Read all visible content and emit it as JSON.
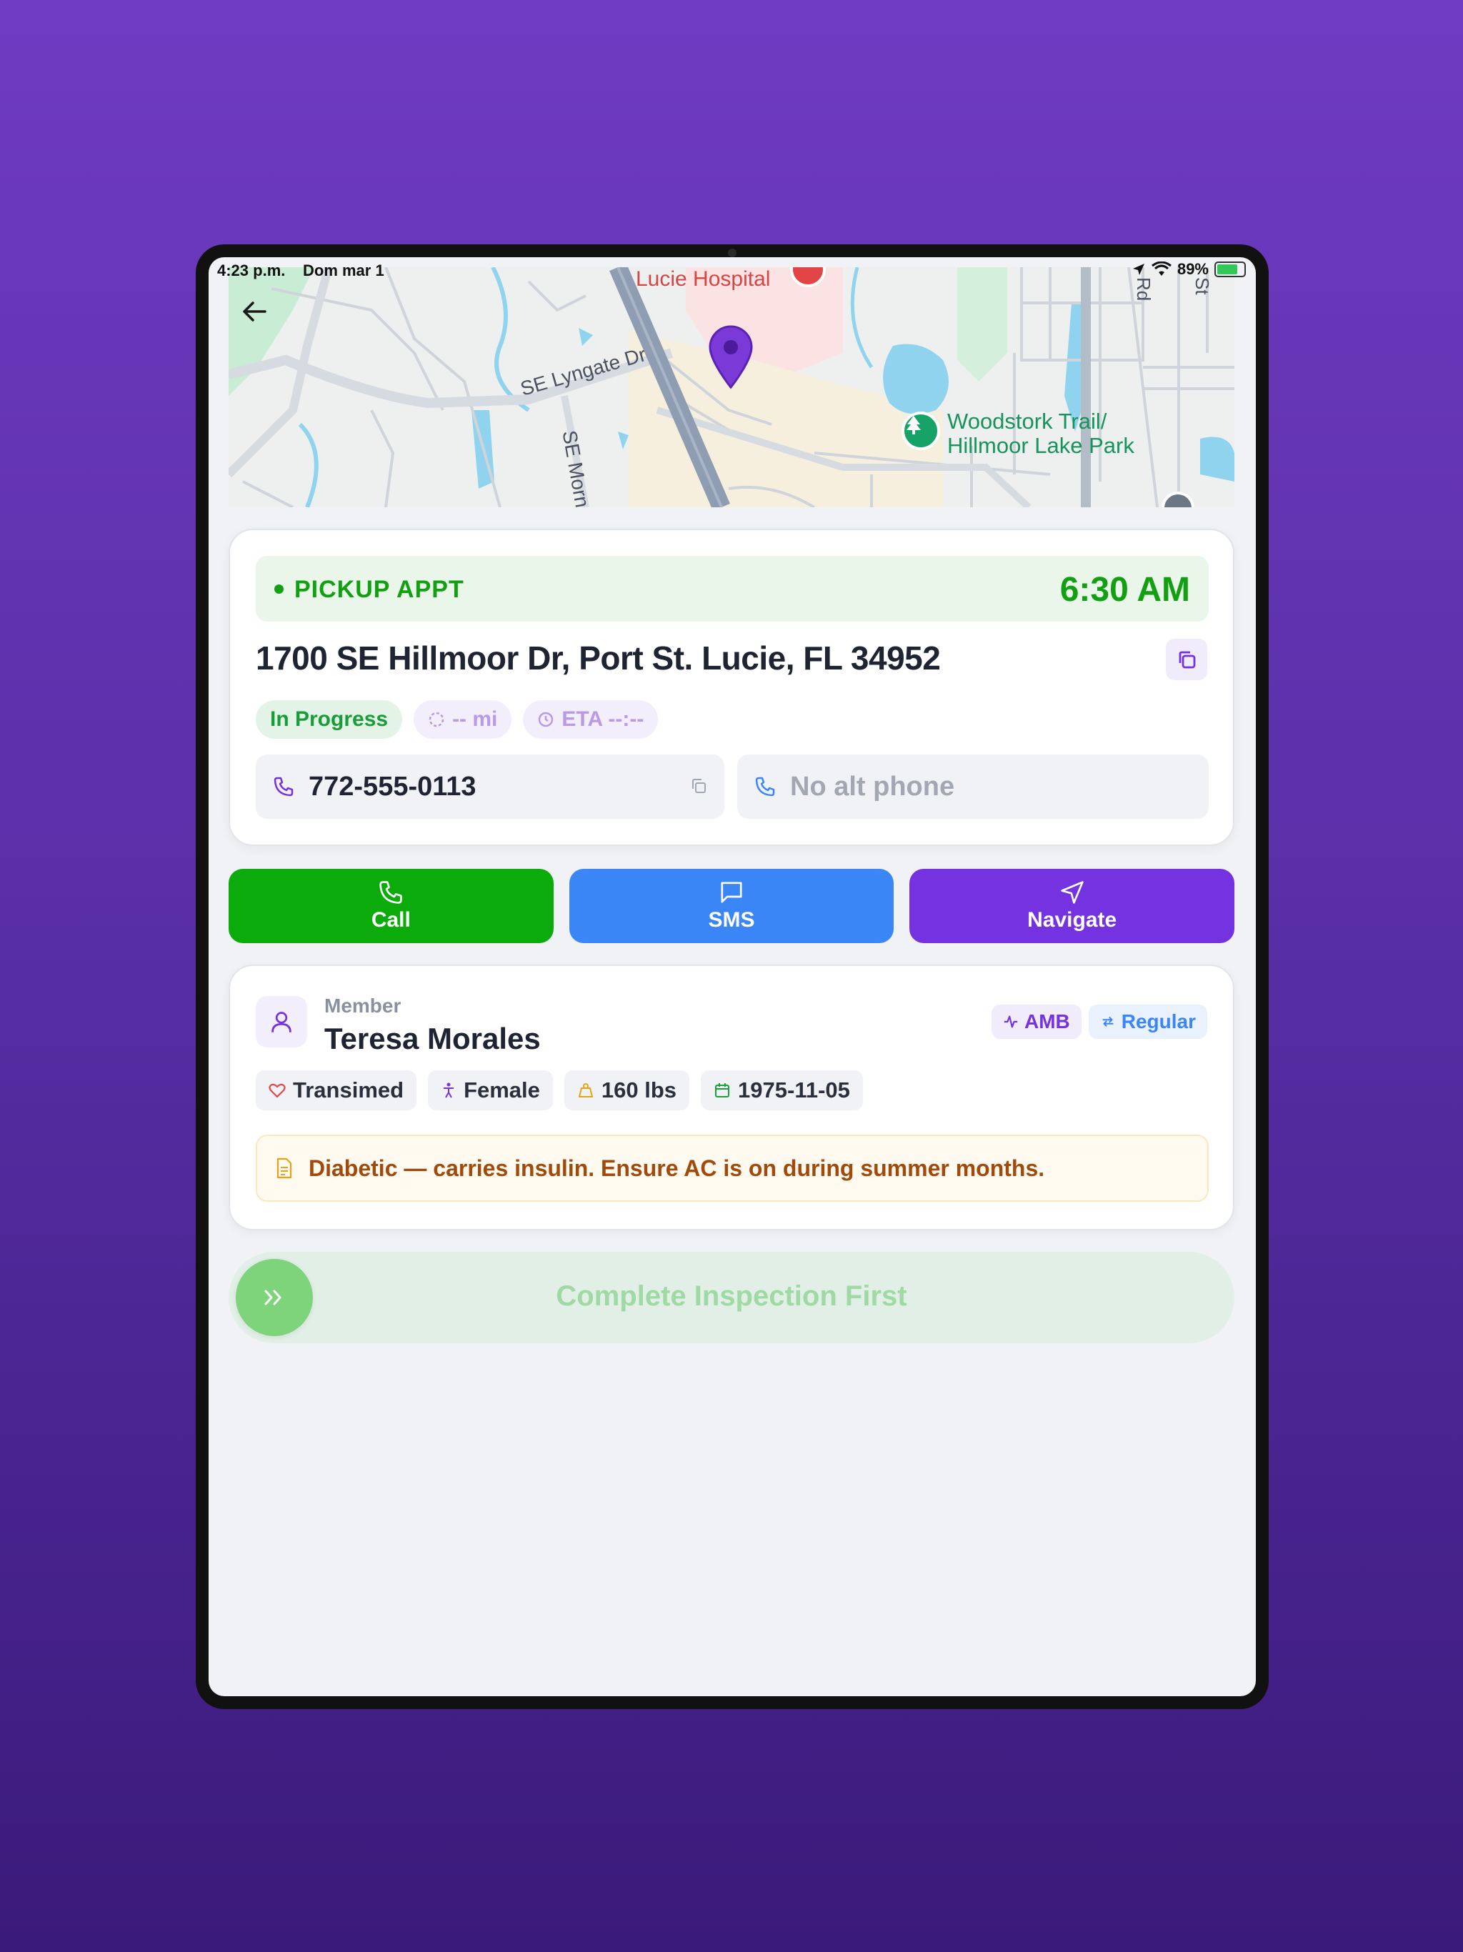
{
  "status_bar": {
    "time": "4:23 p.m.",
    "date": "Dom mar 1",
    "battery": "89%"
  },
  "map": {
    "labels": {
      "hospital": "Lucie Hospital",
      "street_lyngate": "SE Lyngate Dr",
      "street_morn": "SE Morn",
      "park_line1": "Woodstork Trail/",
      "park_line2": "Hillmoor Lake Park",
      "edge_rd": "Rd",
      "edge_st": "St"
    }
  },
  "pickup": {
    "label": "PICKUP APPT",
    "time": "6:30 AM",
    "address": "1700 SE Hillmoor Dr, Port St. Lucie, FL 34952",
    "status": "In Progress",
    "distance": "-- mi",
    "eta": "ETA --:--",
    "phone": "772-555-0113",
    "alt_phone": "No alt phone"
  },
  "actions": {
    "call": "Call",
    "sms": "SMS",
    "navigate": "Navigate"
  },
  "member": {
    "label": "Member",
    "name": "Teresa Morales",
    "badge_amb": "AMB",
    "badge_regular": "Regular",
    "insurance": "Transimed",
    "gender": "Female",
    "weight": "160 lbs",
    "dob": "1975-11-05",
    "note": "Diabetic — carries insulin. Ensure AC is on during summer months."
  },
  "swipe": {
    "label": "Complete Inspection First"
  },
  "colors": {
    "green": "#0cab0c",
    "blue": "#3b86f6",
    "purple": "#7432e0",
    "note_text": "#a24a0c"
  }
}
